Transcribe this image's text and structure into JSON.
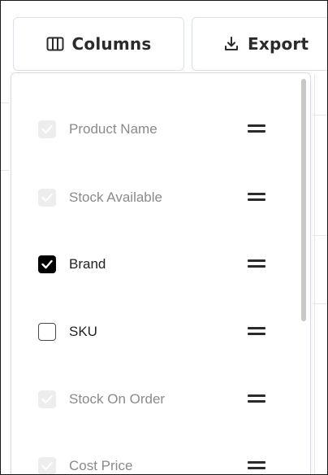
{
  "toolbar": {
    "columns_label": "Columns",
    "export_label": "Export"
  },
  "columns_menu": {
    "items": [
      {
        "label": "Product Name",
        "state": "disabled-checked"
      },
      {
        "label": "Stock Available",
        "state": "disabled-checked"
      },
      {
        "label": "Brand",
        "state": "checked"
      },
      {
        "label": "SKU",
        "state": "unchecked"
      },
      {
        "label": "Stock On Order",
        "state": "disabled-checked"
      },
      {
        "label": "Cost Price",
        "state": "disabled-checked"
      }
    ]
  },
  "colors": {
    "text_primary": "#222222",
    "text_muted": "#8a8a8a",
    "checkbox_checked": "#000000",
    "checkbox_disabled": "#ededee",
    "border": "#dcdfe4"
  },
  "icons": {
    "columns": "columns-icon",
    "export": "download-icon",
    "drag": "drag-handle-icon",
    "check": "check-icon"
  }
}
